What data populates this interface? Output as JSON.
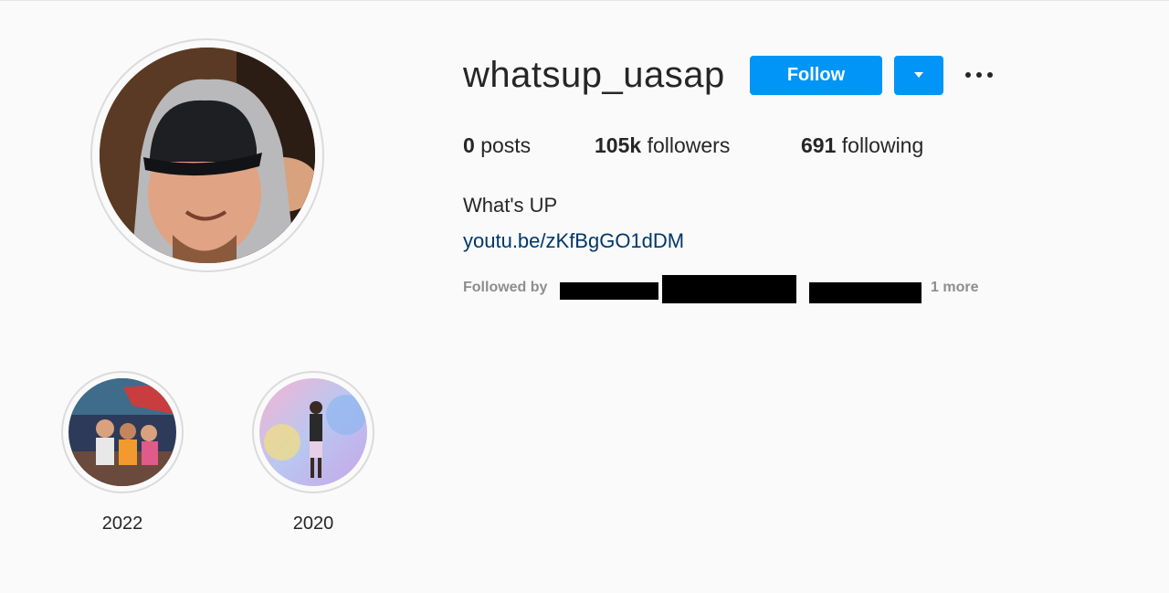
{
  "profile": {
    "username": "whatsup_uasap",
    "follow_label": "Follow",
    "posts_count": "0",
    "posts_label": "posts",
    "followers_count": "105k",
    "followers_label": "followers",
    "following_count": "691",
    "following_label": "following",
    "bio_name": "What's UP",
    "bio_link": "youtu.be/zKfBgGO1dDM",
    "followed_by_label": "Followed by",
    "followed_by_more": "1 more"
  },
  "highlights": [
    {
      "label": "2022"
    },
    {
      "label": "2020"
    }
  ],
  "colors": {
    "accent": "#0095f6",
    "link": "#00376b",
    "muted": "#8e8e8e"
  }
}
